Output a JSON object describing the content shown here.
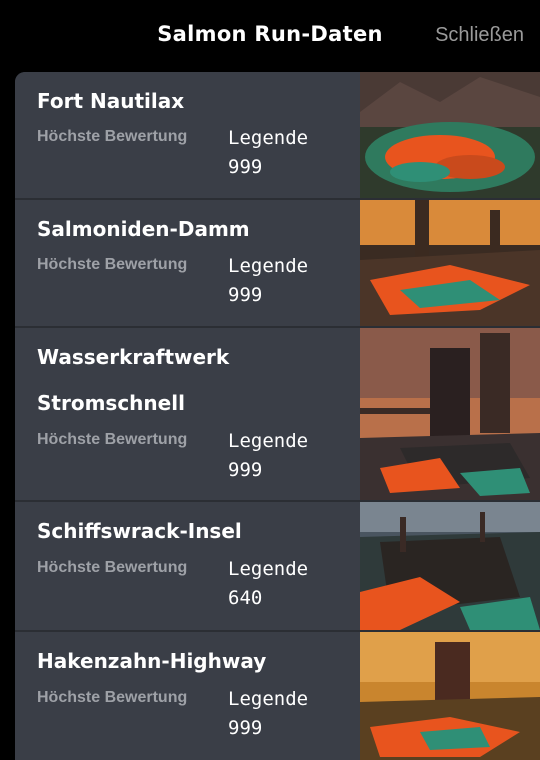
{
  "header": {
    "title": "Salmon Run-Daten",
    "close_label": "Schließen"
  },
  "stages": [
    {
      "name": "Fort Nautilax",
      "label": "Höchste Bewertung",
      "rank": "Legende",
      "score": "999"
    },
    {
      "name": "Salmoniden-Damm",
      "label": "Höchste Bewertung",
      "rank": "Legende",
      "score": "999"
    },
    {
      "name": "Wasserkraftwerk Stromschnell",
      "label": "Höchste Bewertung",
      "rank": "Legende",
      "score": "999"
    },
    {
      "name": "Schiffswrack-Insel",
      "label": "Höchste Bewertung",
      "rank": "Legende",
      "score": "640"
    },
    {
      "name": "Hakenzahn-Highway",
      "label": "Höchste Bewertung",
      "rank": "Legende",
      "score": "999"
    }
  ],
  "colors": {
    "accent_orange": "#e8541e",
    "accent_teal": "#2f8f76",
    "panel": "#3a3e47"
  }
}
